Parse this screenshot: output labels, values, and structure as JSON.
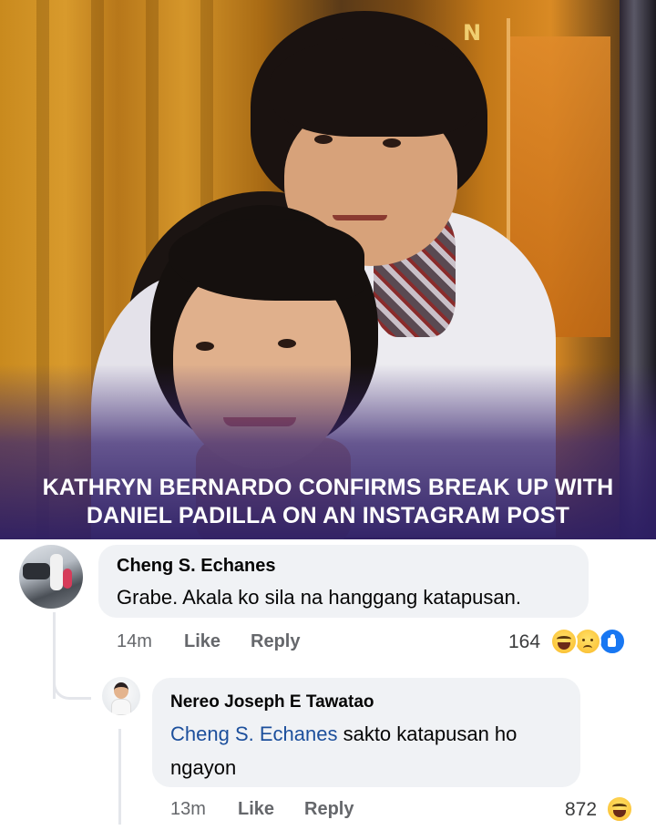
{
  "post": {
    "headline": "KATHRYN BERNARDO CONFIRMS BREAK UP WITH\nDANIEL PADILLA ON AN INSTAGRAM POST"
  },
  "comments": [
    {
      "author": "Cheng S. Echanes",
      "text": "Grabe. Akala ko sila na hanggang katapusan.",
      "time": "14m",
      "like_label": "Like",
      "reply_label": "Reply",
      "reaction_count": "164",
      "reactions": [
        "haha-icon",
        "sad-icon",
        "like-icon"
      ]
    },
    {
      "author": "Nereo Joseph E Tawatao",
      "mention": "Cheng S. Echanes",
      "text_line1": " sakto katapusan ho",
      "text_line2": "ngayon",
      "time": "13m",
      "like_label": "Like",
      "reply_label": "Reply",
      "reaction_count": "872",
      "reactions": [
        "haha-icon"
      ]
    }
  ],
  "colors": {
    "bubble": "#f0f2f5",
    "meta_gray": "#65676b",
    "mention_blue": "#1c4f9c",
    "headline_overlay": "#2d1e64"
  }
}
